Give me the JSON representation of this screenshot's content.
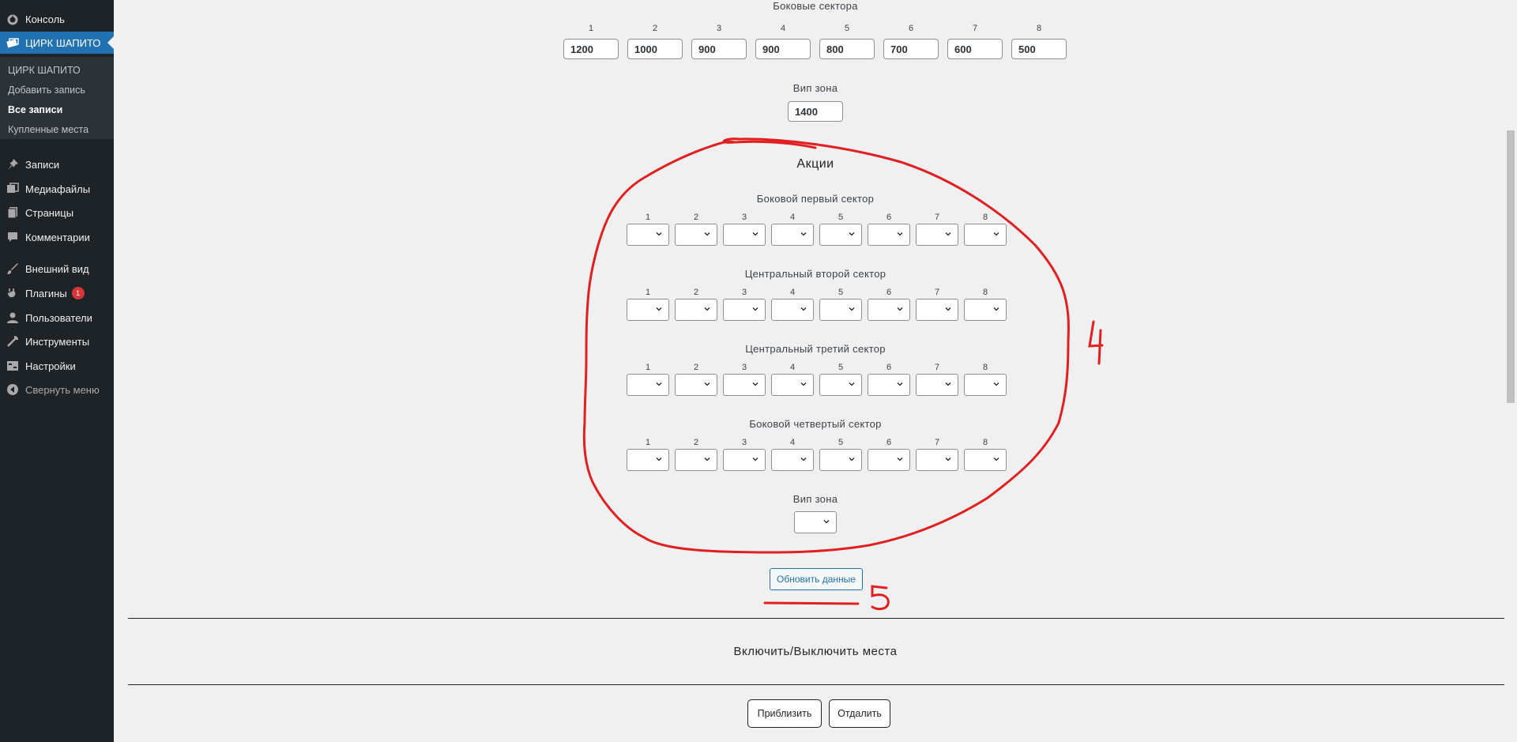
{
  "sidebar": {
    "items": [
      {
        "label": "Консоль",
        "icon": "dashboard-icon"
      },
      {
        "label": "ЦИРК ШАПИТО",
        "icon": "tickets-icon",
        "active": true
      },
      {
        "label": "Записи",
        "icon": "pin-icon"
      },
      {
        "label": "Медиафайлы",
        "icon": "media-icon"
      },
      {
        "label": "Страницы",
        "icon": "pages-icon"
      },
      {
        "label": "Комментарии",
        "icon": "comments-icon"
      },
      {
        "label": "Внешний вид",
        "icon": "appearance-icon"
      },
      {
        "label": "Плагины",
        "icon": "plugins-icon",
        "badge": "1"
      },
      {
        "label": "Пользователи",
        "icon": "users-icon"
      },
      {
        "label": "Инструменты",
        "icon": "tools-icon"
      },
      {
        "label": "Настройки",
        "icon": "settings-icon"
      }
    ],
    "submenu": [
      "ЦИРК ШАПИТО",
      "Добавить запись",
      "Все записи",
      "Купленные места"
    ],
    "collapse_label": "Свернуть меню"
  },
  "prices": {
    "side_sectors_title": "Боковые сектора",
    "columns": [
      "1",
      "2",
      "3",
      "4",
      "5",
      "6",
      "7",
      "8"
    ],
    "values": [
      "1200",
      "1000",
      "900",
      "900",
      "800",
      "700",
      "600",
      "500"
    ],
    "vip_title": "Вип зона",
    "vip_value": "1400"
  },
  "promotions": {
    "title": "Акции",
    "columns": [
      "1",
      "2",
      "3",
      "4",
      "5",
      "6",
      "7",
      "8"
    ],
    "sectors": [
      {
        "title": "Боковой первый сектор"
      },
      {
        "title": "Центральный второй сектор"
      },
      {
        "title": "Центральный третий сектор"
      },
      {
        "title": "Боковой четвертый сектор"
      }
    ],
    "vip_title": "Вип зона"
  },
  "buttons": {
    "update": "Обновить данные",
    "zoom_in": "Приблизить",
    "zoom_out": "Отдалить"
  },
  "seats_section_title": "Включить/Выключить места",
  "annotations": {
    "number_4": "4",
    "number_5": "5",
    "color": "#e02020"
  }
}
